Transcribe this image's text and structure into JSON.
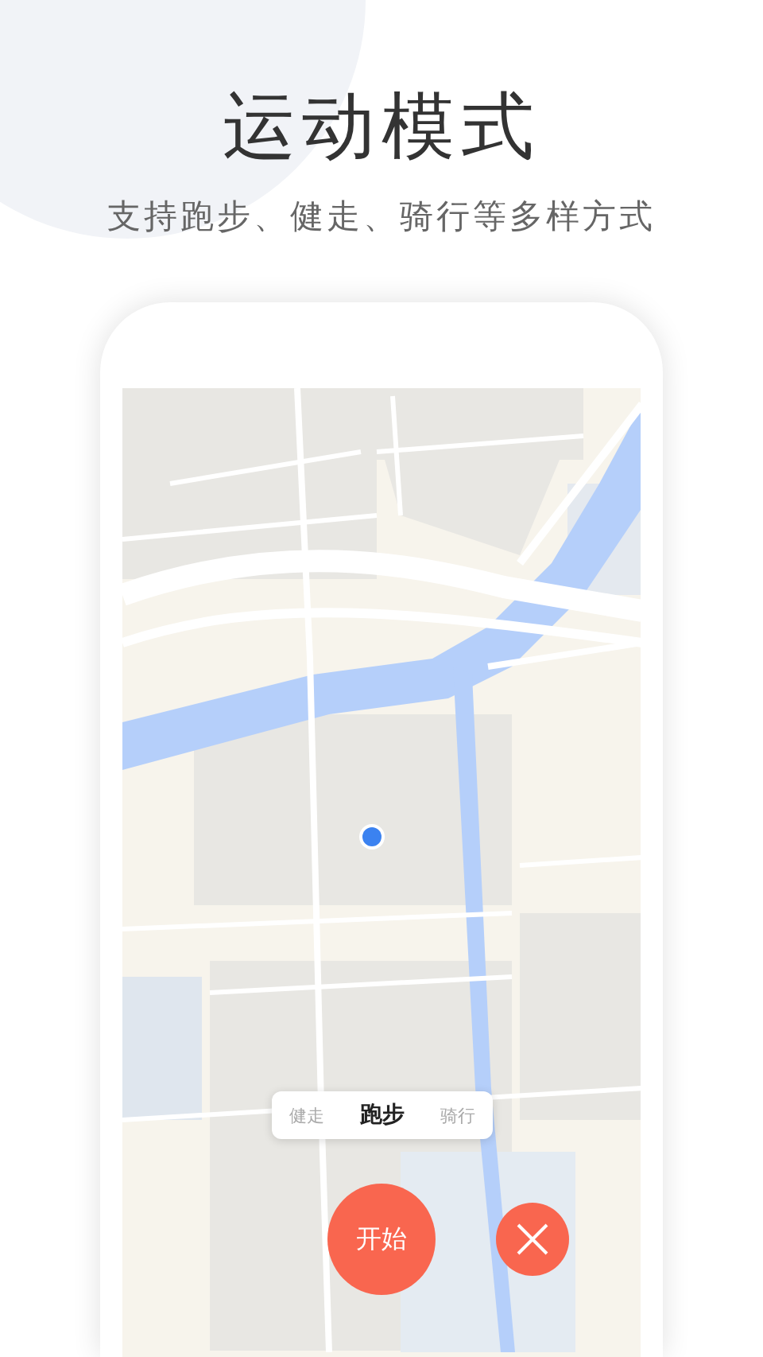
{
  "header": {
    "title": "运动模式",
    "subtitle": "支持跑步、健走、骑行等多样方式"
  },
  "modes": [
    {
      "label": "健走",
      "selected": false
    },
    {
      "label": "跑步",
      "selected": true
    },
    {
      "label": "骑行",
      "selected": false
    }
  ],
  "start_button": {
    "label": "开始"
  }
}
